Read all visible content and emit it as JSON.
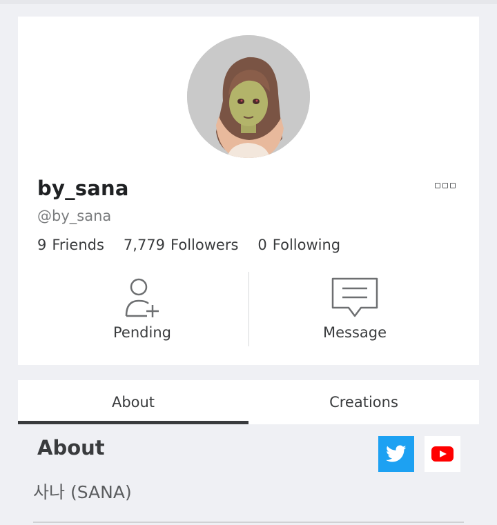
{
  "profile": {
    "display_name": "by_sana",
    "username": "@by_sana",
    "stats": [
      {
        "count": "9",
        "label": "Friends"
      },
      {
        "count": "7,779",
        "label": "Followers"
      },
      {
        "count": "0",
        "label": "Following"
      }
    ]
  },
  "actions": {
    "pending_label": "Pending",
    "message_label": "Message"
  },
  "tabs": [
    {
      "label": "About",
      "active": true
    },
    {
      "label": "Creations",
      "active": false
    }
  ],
  "about": {
    "heading": "About",
    "description": "사나 (SANA)"
  },
  "social": {
    "twitter_color": "#1da1f2",
    "youtube_color": "#ff0000"
  },
  "icons": [
    "more-options-icon",
    "add-friend-icon",
    "message-icon",
    "twitter-icon",
    "youtube-icon"
  ]
}
